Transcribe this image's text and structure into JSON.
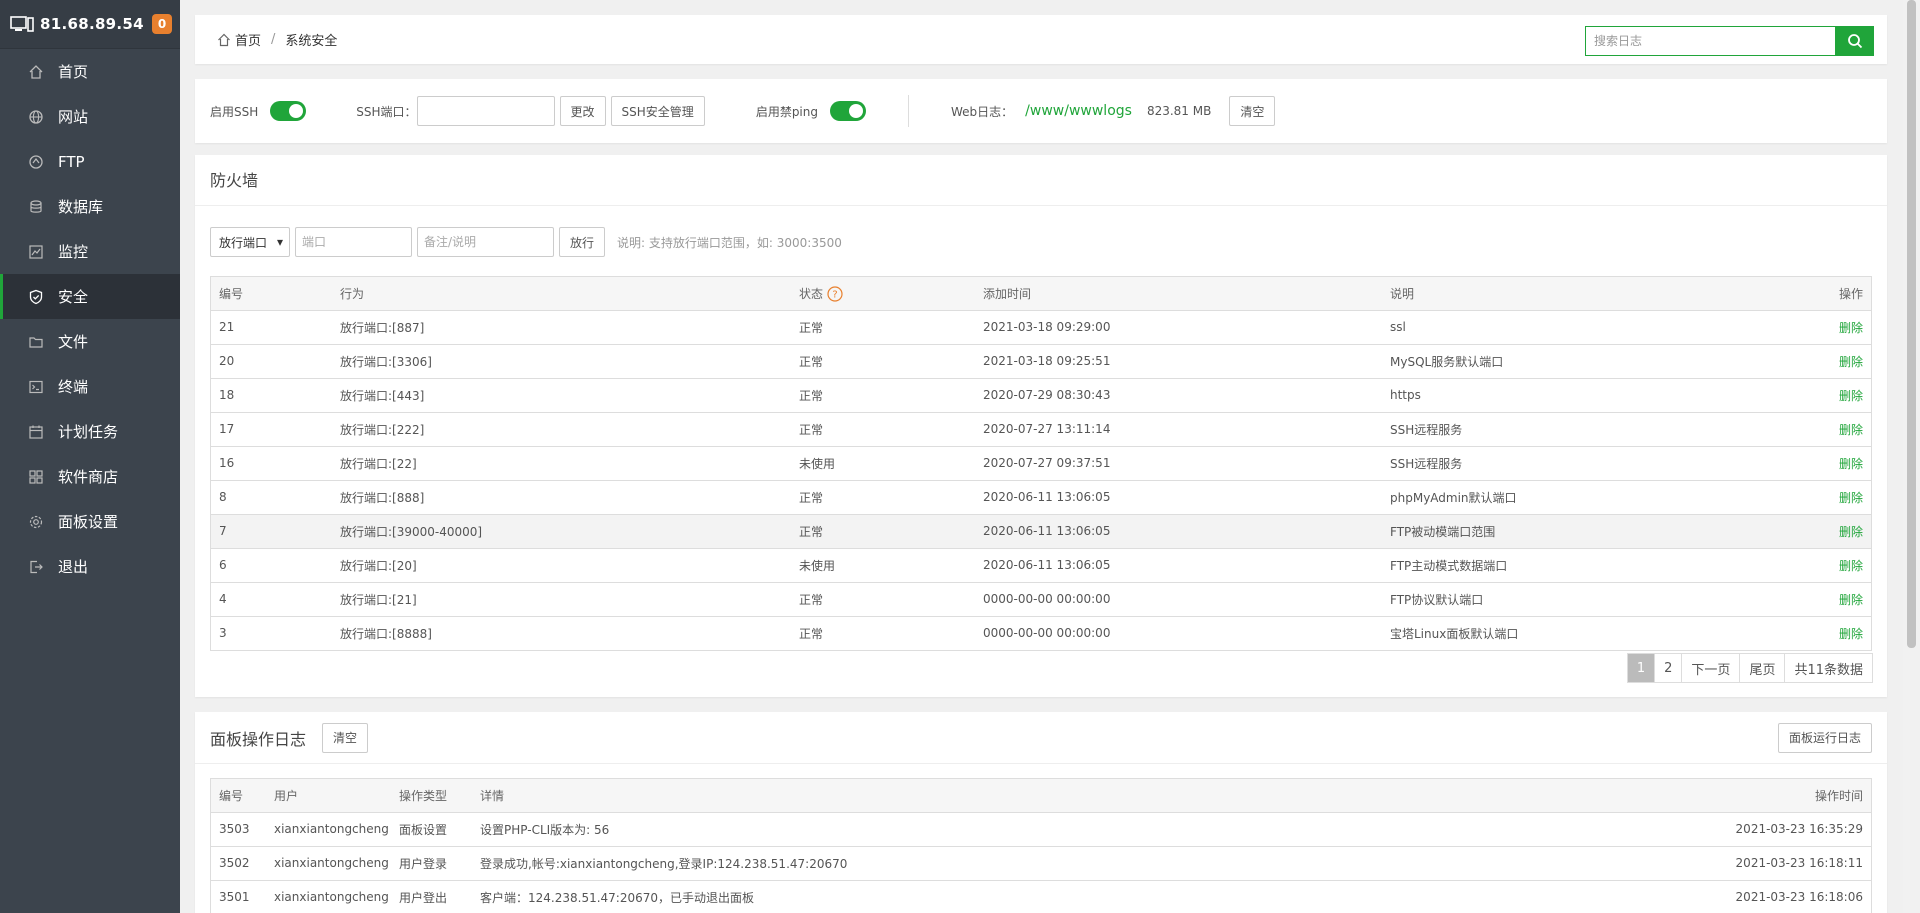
{
  "sidebar": {
    "ip": "81.68.89.54",
    "badge": "0",
    "items": [
      {
        "label": "首页",
        "icon": "home-icon"
      },
      {
        "label": "网站",
        "icon": "globe-icon"
      },
      {
        "label": "FTP",
        "icon": "ftp-icon"
      },
      {
        "label": "数据库",
        "icon": "database-icon"
      },
      {
        "label": "监控",
        "icon": "monitor-icon"
      },
      {
        "label": "安全",
        "icon": "shield-icon",
        "active": true
      },
      {
        "label": "文件",
        "icon": "folder-icon"
      },
      {
        "label": "终端",
        "icon": "terminal-icon"
      },
      {
        "label": "计划任务",
        "icon": "calendar-icon"
      },
      {
        "label": "软件商店",
        "icon": "apps-icon"
      },
      {
        "label": "面板设置",
        "icon": "settings-icon"
      },
      {
        "label": "退出",
        "icon": "logout-icon"
      }
    ]
  },
  "breadcrumb": {
    "home": "首页",
    "sep": "/",
    "current": "系统安全"
  },
  "search": {
    "placeholder": "搜索日志"
  },
  "toolbar": {
    "ssh_label": "启用SSH",
    "ssh_port_label": "SSH端口：",
    "ssh_port_value": "",
    "change_btn": "更改",
    "ssh_manage_btn": "SSH安全管理",
    "ping_label": "启用禁ping",
    "weblog_label": "Web日志：",
    "weblog_path": "/www/wwwlogs",
    "weblog_size": "823.81 MB",
    "clear_btn": "清空"
  },
  "firewall": {
    "title": "防火墙",
    "select_value": "放行端口",
    "port_placeholder": "端口",
    "note_placeholder": "备注/说明",
    "allow_btn": "放行",
    "hint": "说明: 支持放行端口范围，如: 3000:3500",
    "columns": [
      "编号",
      "行为",
      "状态",
      "添加时间",
      "说明",
      "操作"
    ],
    "rows": [
      {
        "id": "21",
        "action": "放行端口:[887]",
        "status": "正常",
        "time": "2021-03-18 09:29:00",
        "note": "ssl",
        "op": "删除"
      },
      {
        "id": "20",
        "action": "放行端口:[3306]",
        "status": "正常",
        "time": "2021-03-18 09:25:51",
        "note": "MySQL服务默认端口",
        "op": "删除"
      },
      {
        "id": "18",
        "action": "放行端口:[443]",
        "status": "正常",
        "time": "2020-07-29 08:30:43",
        "note": "https",
        "op": "删除"
      },
      {
        "id": "17",
        "action": "放行端口:[222]",
        "status": "正常",
        "time": "2020-07-27 13:11:14",
        "note": "SSH远程服务",
        "op": "删除"
      },
      {
        "id": "16",
        "action": "放行端口:[22]",
        "status": "未使用",
        "time": "2020-07-27 09:37:51",
        "note": "SSH远程服务",
        "op": "删除"
      },
      {
        "id": "8",
        "action": "放行端口:[888]",
        "status": "正常",
        "time": "2020-06-11 13:06:05",
        "note": "phpMyAdmin默认端口",
        "op": "删除"
      },
      {
        "id": "7",
        "action": "放行端口:[39000-40000]",
        "status": "正常",
        "time": "2020-06-11 13:06:05",
        "note": "FTP被动模端口范围",
        "op": "删除"
      },
      {
        "id": "6",
        "action": "放行端口:[20]",
        "status": "未使用",
        "time": "2020-06-11 13:06:05",
        "note": "FTP主动模式数据端口",
        "op": "删除"
      },
      {
        "id": "4",
        "action": "放行端口:[21]",
        "status": "正常",
        "time": "0000-00-00 00:00:00",
        "note": "FTP协议默认端口",
        "op": "删除"
      },
      {
        "id": "3",
        "action": "放行端口:[8888]",
        "status": "正常",
        "time": "0000-00-00 00:00:00",
        "note": "宝塔Linux面板默认端口",
        "op": "删除"
      }
    ],
    "pager": {
      "p1": "1",
      "p2": "2",
      "next": "下一页",
      "last": "尾页",
      "total": "共11条数据"
    }
  },
  "panel_log": {
    "title": "面板操作日志",
    "clear_btn": "清空",
    "run_log_btn": "面板运行日志",
    "columns": [
      "编号",
      "用户",
      "操作类型",
      "详情",
      "操作时间"
    ],
    "rows": [
      {
        "id": "3503",
        "user": "xianxiantongcheng",
        "type": "面板设置",
        "detail": "设置PHP-CLI版本为: 56",
        "time": "2021-03-23 16:35:29"
      },
      {
        "id": "3502",
        "user": "xianxiantongcheng",
        "type": "用户登录",
        "detail": "登录成功,帐号:xianxiantongcheng,登录IP:124.238.51.47:20670",
        "time": "2021-03-23 16:18:11"
      },
      {
        "id": "3501",
        "user": "xianxiantongcheng",
        "type": "用户登出",
        "detail": "客户端：124.238.51.47:20670，已手动退出面板",
        "time": "2021-03-23 16:18:06"
      }
    ]
  },
  "colors": {
    "accent": "#20a53a",
    "sidebar_bg": "#3c444d",
    "badge": "#e8802e"
  }
}
